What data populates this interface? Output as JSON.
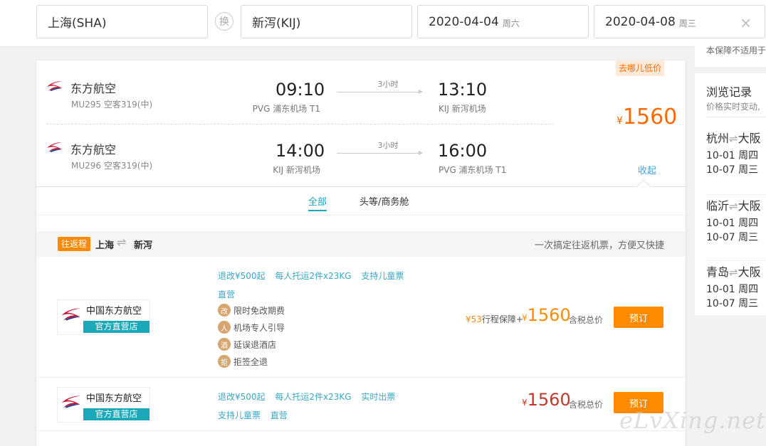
{
  "search": {
    "from": "上海(SHA)",
    "to": "新泻(KIJ)",
    "swap_label": "换",
    "depart_date": "2020-04-04",
    "depart_weekday": "周六",
    "return_date": "2020-04-08",
    "return_weekday": "周三",
    "clear_symbol": "×"
  },
  "flight": {
    "tag": "去哪儿低价",
    "price_currency": "¥",
    "price": "1560",
    "collapse_label": "收起",
    "legs": [
      {
        "airline": "东方航空",
        "flight_no": "MU295 空客319(中)",
        "dep_time": "09:10",
        "dep_airport": "PVG 浦东机场 T1",
        "duration": "3小时",
        "arr_time": "13:10",
        "arr_airport": "KIJ 新泻机场"
      },
      {
        "airline": "东方航空",
        "flight_no": "MU296 空客319(中)",
        "dep_time": "14:00",
        "dep_airport": "KIJ 新泻机场",
        "duration": "3小时",
        "arr_time": "16:00",
        "arr_airport": "PVG 浦东机场 T1"
      }
    ]
  },
  "tabs": [
    "全部",
    "头等/商务舱"
  ],
  "roundtrip": {
    "badge": "往返程",
    "from": "上海",
    "to": "新泻",
    "slogan": "一次搞定往返机票，方便又快捷"
  },
  "offers": [
    {
      "store_name": "中国东方航空",
      "store_badge": "官方直营店",
      "links_line1": [
        "退改¥500起",
        "每人托运2件x23KG",
        "支持儿童票"
      ],
      "links_line2": [
        "直营"
      ],
      "perks": [
        {
          "icon": "改",
          "label": "限时免改期费"
        },
        {
          "icon": "人",
          "label": "机场专人引导"
        },
        {
          "icon": "酒",
          "label": "延误退酒店"
        },
        {
          "icon": "拒",
          "label": "拒签全退"
        }
      ],
      "insurance_price": "¥53",
      "insurance_label": "行程保障+",
      "price_currency": "¥",
      "price": "1560",
      "tax_note": "含税总价",
      "book_label": "预订"
    },
    {
      "store_name": "中国东方航空",
      "store_badge": "官方直营店",
      "links_line1": [
        "退改¥500起",
        "每人托运2件x23KG",
        "实时出票"
      ],
      "links_line2": [
        "支持儿童票",
        "直营"
      ],
      "price_currency": "¥",
      "price": "1560",
      "tax_note": "含税总价",
      "book_label": "预订"
    }
  ],
  "sidebar": {
    "note": "本保障不适用于",
    "history_title": "浏览记录",
    "history_sub": "价格实时变动,",
    "items": [
      {
        "from": "杭州",
        "to": "大阪",
        "date1": "10-01 周四",
        "date2": "10-07 周三"
      },
      {
        "from": "临沂",
        "to": "大阪",
        "date1": "10-01 周四",
        "date2": "10-07 周三"
      },
      {
        "from": "青岛",
        "to": "大阪",
        "date1": "10-01 周四",
        "date2": "10-07 周三"
      }
    ]
  },
  "watermark": "eLvXing.net",
  "colors": {
    "accent": "#ff8a00",
    "link": "#3aa8c4",
    "teal": "#1ba9ba",
    "price_dark": "#c0392b"
  }
}
